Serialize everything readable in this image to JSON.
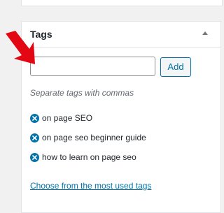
{
  "panel": {
    "title": "Tags"
  },
  "tag_input": {
    "value": "",
    "placeholder": ""
  },
  "add_button": {
    "label": "Add"
  },
  "howto": "Separate tags with commas",
  "tags": [
    {
      "label": "on page SEO"
    },
    {
      "label": "on page seo beginner guide"
    },
    {
      "label": "how to learn on page seo"
    }
  ],
  "most_used_link": "Choose from the most used tags",
  "colors": {
    "accent": "#0073aa",
    "annotation_arrow": "#e30613",
    "panel_bg": "#ffffff",
    "page_bg": "#f1f1f1"
  },
  "icons": {
    "remove": "remove-circle-icon",
    "toggle": "caret-up-icon",
    "annotation": "red-arrow-icon"
  }
}
